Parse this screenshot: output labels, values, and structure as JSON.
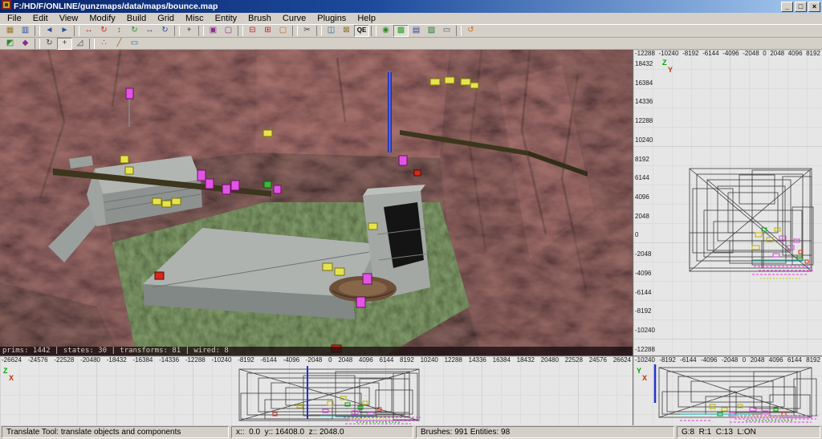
{
  "window": {
    "title": "F:/HD/F/ONLINE/gunzmaps/data/maps/bounce.map",
    "controls": [
      {
        "name": "minimize",
        "glyph": "_"
      },
      {
        "name": "maximize",
        "glyph": "□"
      },
      {
        "name": "close",
        "glyph": "×"
      }
    ]
  },
  "menu": {
    "items": [
      "File",
      "Edit",
      "View",
      "Modify",
      "Build",
      "Grid",
      "Misc",
      "Entity",
      "Brush",
      "Curve",
      "Plugins",
      "Help"
    ]
  },
  "toolbar_row1": [
    {
      "name": "open",
      "glyph": "▦",
      "color": "#a07818"
    },
    {
      "name": "save",
      "glyph": "▥",
      "color": "#2a4f9a"
    },
    {
      "sep": true
    },
    {
      "name": "undo",
      "glyph": "◄",
      "color": "#2a4f9a"
    },
    {
      "name": "redo",
      "glyph": "►",
      "color": "#2a4f9a"
    },
    {
      "sep": true
    },
    {
      "name": "x-flip",
      "glyph": "↔",
      "color": "#c42525"
    },
    {
      "name": "x-rotate",
      "glyph": "↻",
      "color": "#c42525"
    },
    {
      "name": "y-flip",
      "glyph": "↕",
      "color": "#2a8a2a"
    },
    {
      "name": "y-rotate",
      "glyph": "↻",
      "color": "#2a8a2a"
    },
    {
      "name": "z-flip",
      "glyph": "↔",
      "color": "#2a4f9a"
    },
    {
      "name": "z-rotate",
      "glyph": "↻",
      "color": "#2a4f9a"
    },
    {
      "sep": true
    },
    {
      "name": "complex-move",
      "glyph": "+",
      "color": "#444444"
    },
    {
      "sep": true
    },
    {
      "name": "select-touching",
      "glyph": "▣",
      "color": "#8a2a8a"
    },
    {
      "name": "select-inside",
      "glyph": "▢",
      "color": "#8a2a8a"
    },
    {
      "sep": true
    },
    {
      "name": "csg-subtract",
      "glyph": "⊟",
      "color": "#c42525"
    },
    {
      "name": "csg-merge",
      "glyph": "⊞",
      "color": "#c42525"
    },
    {
      "name": "make-hollow",
      "glyph": "▢",
      "color": "#c46a18"
    },
    {
      "sep": true
    },
    {
      "name": "clipper",
      "glyph": "✂",
      "color": "#444444"
    },
    {
      "sep": true
    },
    {
      "name": "change-views",
      "glyph": "◫",
      "color": "#2a6a8a"
    },
    {
      "name": "texture-lock",
      "glyph": "⊠",
      "color": "#8a6d1a"
    },
    {
      "name": "qe-tool",
      "glyph": "QE",
      "color": "#000000",
      "pressed": true
    },
    {
      "sep": true
    },
    {
      "name": "camera-mode",
      "glyph": "◉",
      "color": "#2a8a2a"
    },
    {
      "name": "texture-mode",
      "glyph": "▩",
      "color": "#2aa02a",
      "pressed": true
    },
    {
      "name": "entity-list",
      "glyph": "▤",
      "color": "#3a3aa0"
    },
    {
      "name": "surface-inspector",
      "glyph": "▨",
      "color": "#2a7a2a"
    },
    {
      "name": "console",
      "glyph": "▭",
      "color": "#555555"
    },
    {
      "sep": true
    },
    {
      "name": "refresh-models",
      "glyph": "↺",
      "color": "#d06a18"
    }
  ],
  "toolbar_row2": [
    {
      "name": "show-entities",
      "glyph": "◩",
      "color": "#2a8a2a"
    },
    {
      "name": "show-models",
      "glyph": "◆",
      "color": "#8a2a8a"
    },
    {
      "sep": true
    },
    {
      "name": "rotate-tool",
      "glyph": "↻",
      "color": "#444444"
    },
    {
      "name": "translate-tool",
      "glyph": "+",
      "color": "#444444",
      "pressed": true
    },
    {
      "name": "scale-tool",
      "glyph": "◿",
      "color": "#444444"
    },
    {
      "sep": true
    },
    {
      "name": "vertex-mode",
      "glyph": "∴",
      "color": "#a02a2a"
    },
    {
      "name": "edge-mode",
      "glyph": "╱",
      "color": "#a06a2a"
    },
    {
      "name": "face-mode",
      "glyph": "▭",
      "color": "#2a6aa0"
    }
  ],
  "viewport3d": {
    "stats": "prims: 1442 | states: 30 | transforms: 81 | wired: 8"
  },
  "views": {
    "right": {
      "h_ruler": [
        "-12288",
        "-10240",
        "-8192",
        "-6144",
        "-4096",
        "-2048",
        "0",
        "2048",
        "4096",
        "8192"
      ],
      "v_ruler": [
        "18432",
        "16384",
        "14336",
        "12288",
        "10240",
        "8192",
        "6144",
        "4096",
        "2048",
        "0",
        "-2048",
        "-4096",
        "-6144",
        "-8192",
        "-10240",
        "-12288"
      ],
      "axis_v": "Z",
      "axis_h": "Y"
    },
    "bottom_left": {
      "h_ruler": [
        "-26624",
        "-24576",
        "-22528",
        "-20480",
        "-18432",
        "-16384",
        "-14336",
        "-12288",
        "-10240",
        "-8192",
        "-6144",
        "-4096",
        "-2048",
        "0",
        "2048",
        "4096",
        "6144",
        "8192",
        "10240",
        "12288",
        "14336",
        "16384",
        "18432",
        "20480",
        "22528",
        "24576",
        "26624"
      ],
      "axis_v": "Z",
      "axis_h": "X"
    },
    "bottom_right": {
      "h_ruler": [
        "-10240",
        "-8192",
        "-6144",
        "-4096",
        "-2048",
        "0",
        "2048",
        "4096",
        "6144",
        "8192"
      ],
      "axis_v": "Y",
      "axis_h": "X"
    }
  },
  "statusbar": {
    "tool": "Translate Tool: translate objects and components",
    "coords": "x::  0.0  y:: 16408.0  z:: 2048.0",
    "counts": "Brushes: 991 Entities: 98",
    "grid": "G:8  R:1  C:13  L:ON"
  },
  "colors": {
    "titlebar_start": "#0a246a",
    "titlebar_end": "#a6caf0",
    "chrome": "#d4d0c8",
    "view2d_bg": "#e6e6e6",
    "entity_yellow": "#e6e34e",
    "entity_magenta": "#e254e2",
    "entity_red": "#d42a1a",
    "entity_green": "#3eb53e",
    "beam_blue": "#1f2fae"
  }
}
